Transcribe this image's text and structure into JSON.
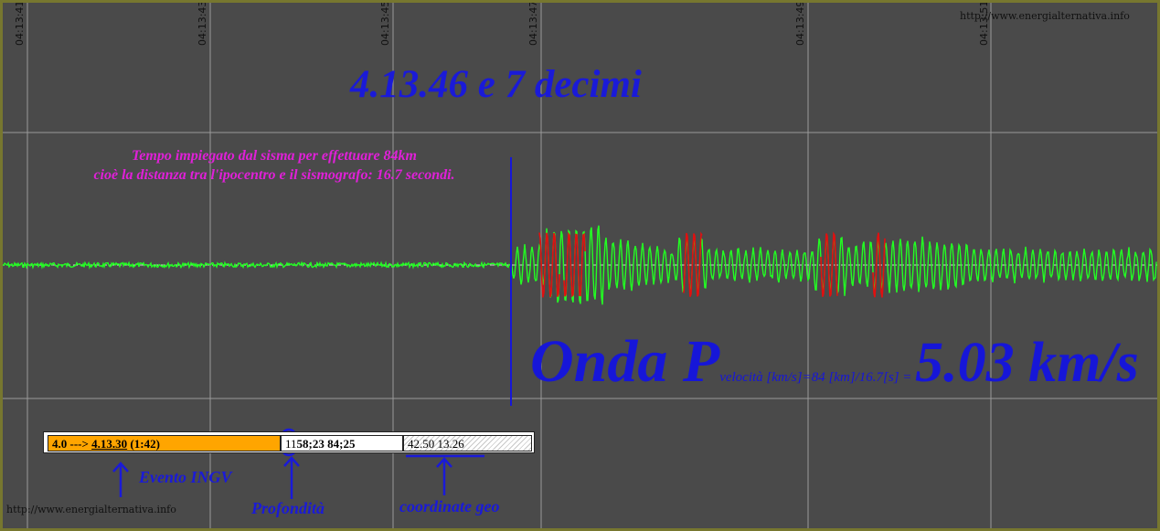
{
  "chart_data": {
    "type": "line",
    "title": "",
    "xlabel": "",
    "ylabel": "",
    "x_tick_labels": [
      "04:13:41",
      "04:13:43",
      "04:13:45",
      "04:13:47",
      "04:13:49",
      "04:13:51"
    ],
    "grid": true,
    "series": [
      {
        "color": "#22ff22",
        "description": "seismogram trace: flat noise before P arrival, oscillations after"
      },
      {
        "color": "#e01010",
        "description": "red highlighted peaks of the P wave"
      }
    ],
    "p_arrival_marker_color": "#1616d8"
  },
  "watermark_top": "http://www.energialternativa.info",
  "watermark_bottom": "http://www.energialternativa.info",
  "headline": "4.13.46 e 7 decimi",
  "note": {
    "line1": "Tempo impiegato dal sisma per effettuare 84km",
    "line2": "cioè la distanza tra l'ipocentro e il sismografo: 16.7 secondi."
  },
  "onda": {
    "big": "Onda P",
    "formula": "velocità [km/s]=84 [km]/16.7[s] = ",
    "result": "5.03 km/s"
  },
  "infobar": {
    "event_prefix": "4.0 ---> ",
    "event_time": "4.13.30",
    "event_suffix": " (1:42)",
    "depth_first": "11",
    "depth_rest": "58;23 84;25",
    "geo": "42.50 13.26"
  },
  "labels": {
    "evento": "Evento INGV",
    "profondita": "Profondità",
    "coordinate": "coordinate geo"
  },
  "colors": {
    "background": "#4a4a4a",
    "grid": "#9a9a9a",
    "trace": "#22ff22",
    "peaks": "#e01010",
    "blue": "#1a1ad8",
    "magenta": "#e020d8",
    "orange": "#ffa500"
  }
}
